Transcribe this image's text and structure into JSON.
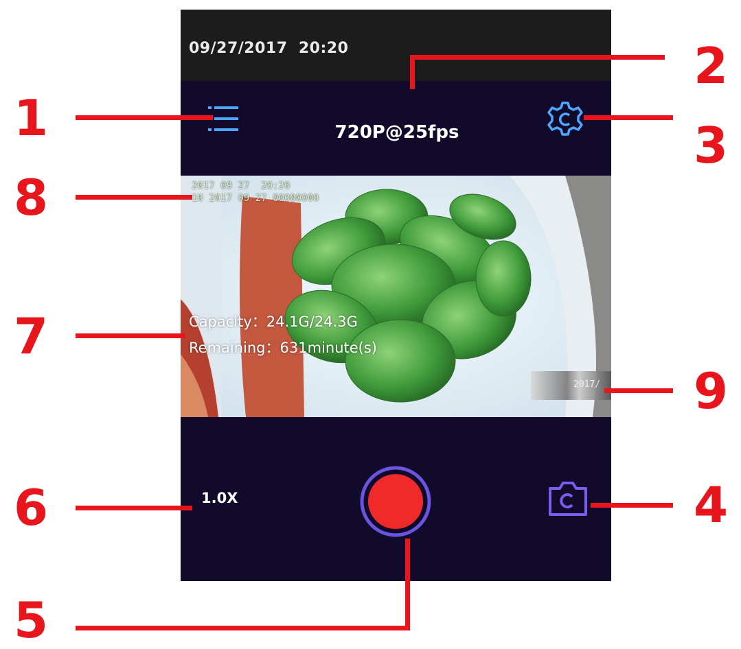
{
  "status_bar": {
    "datetime": "09/27/2017  20:20"
  },
  "toolbar": {
    "resolution": "720P@25fps",
    "menu_icon": "list-menu-icon",
    "settings_icon": "gear-icon"
  },
  "preview": {
    "osd_timestamp": "2017 09 27  20:20\n10 2017 09 27 00000000",
    "capacity_label": "Capacity：24.1G/24.3G",
    "remaining_label": "Remaining：631minute(s)",
    "thumbnail_caption": "2017/"
  },
  "controls": {
    "zoom": "1.0X",
    "record_color": "#f02a2a",
    "ring_color": "#6a55e0",
    "switch_icon": "camera-switch-icon"
  },
  "callouts": [
    "1",
    "2",
    "3",
    "4",
    "5",
    "6",
    "7",
    "8",
    "9"
  ],
  "accent_color": "#e8161c"
}
